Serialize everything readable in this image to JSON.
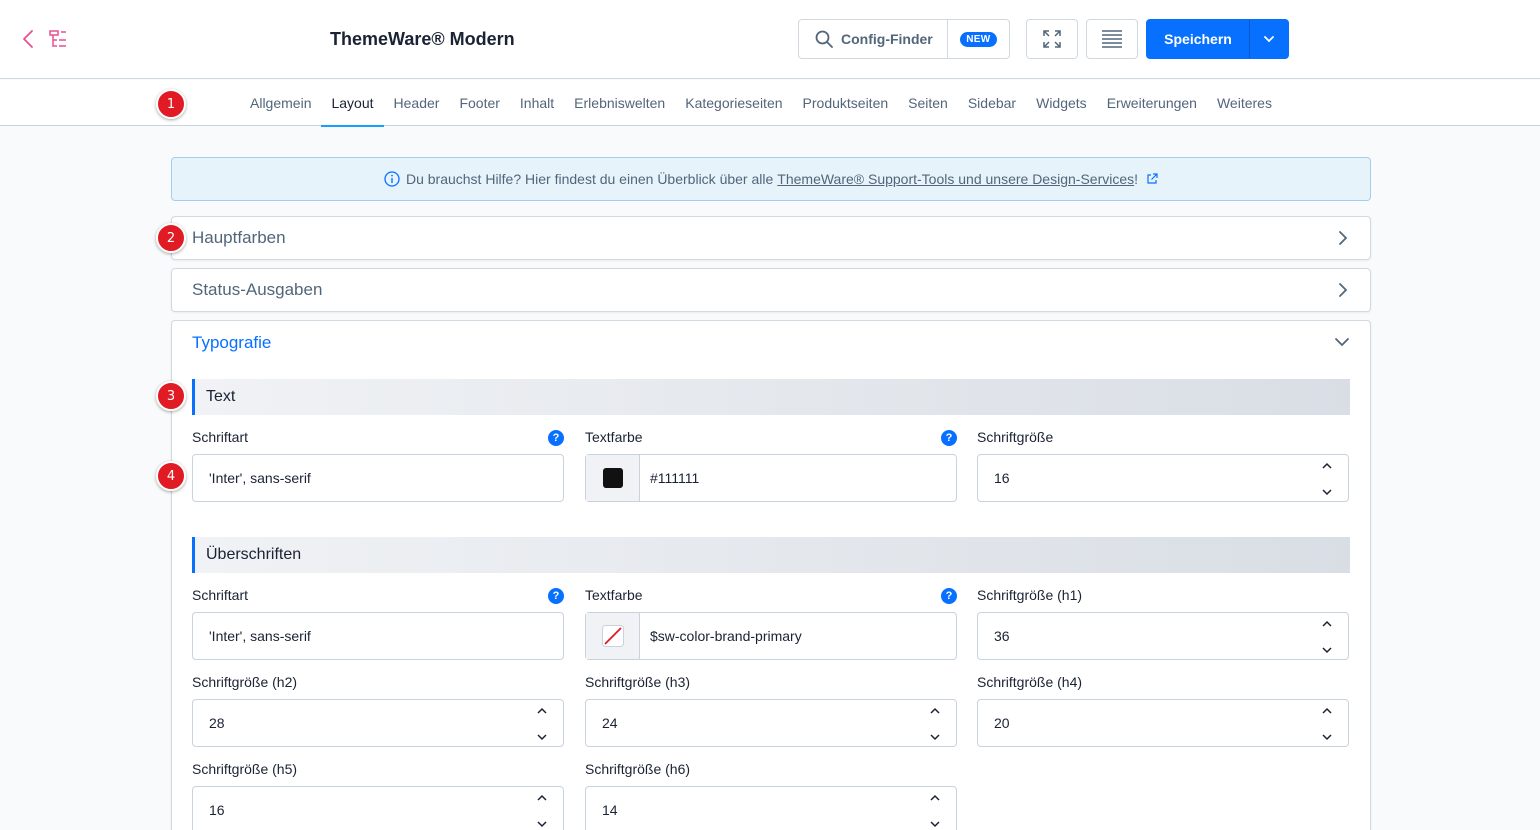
{
  "header": {
    "title": "ThemeWare® Modern",
    "config_finder_label": "Config-Finder",
    "new_badge": "NEW",
    "save_label": "Speichern",
    "accent_color": "#0870ff"
  },
  "tabs": [
    {
      "label": "Allgemein"
    },
    {
      "label": "Layout",
      "active": true
    },
    {
      "label": "Header"
    },
    {
      "label": "Footer"
    },
    {
      "label": "Inhalt"
    },
    {
      "label": "Erlebniswelten"
    },
    {
      "label": "Kategorieseiten"
    },
    {
      "label": "Produktseiten"
    },
    {
      "label": "Seiten"
    },
    {
      "label": "Sidebar"
    },
    {
      "label": "Widgets"
    },
    {
      "label": "Erweiterungen"
    },
    {
      "label": "Weiteres"
    }
  ],
  "markers": [
    "1",
    "2",
    "3",
    "4"
  ],
  "info": {
    "text": "Du brauchst Hilfe? Hier findest du einen Überblick über alle",
    "link": "ThemeWare® Support-Tools und unsere Design-Services",
    "suffix": "!"
  },
  "cards": {
    "hauptfarben": "Hauptfarben",
    "status": "Status-Ausgaben",
    "typografie": "Typografie"
  },
  "text_section": {
    "title": "Text",
    "font_label": "Schriftart",
    "font_value": "'Inter', sans-serif",
    "color_label": "Textfarbe",
    "color_value": "#111111",
    "size_label": "Schriftgröße",
    "size_value": "16"
  },
  "headings_section": {
    "title": "Überschriften",
    "font_label": "Schriftart",
    "font_value": "'Inter', sans-serif",
    "color_label": "Textfarbe",
    "color_value": "$sw-color-brand-primary",
    "h1_label": "Schriftgröße (h1)",
    "h1_value": "36",
    "h2_label": "Schriftgröße (h2)",
    "h2_value": "28",
    "h3_label": "Schriftgröße (h3)",
    "h3_value": "24",
    "h4_label": "Schriftgröße (h4)",
    "h4_value": "20",
    "h5_label": "Schriftgröße (h5)",
    "h5_value": "16",
    "h6_label": "Schriftgröße (h6)",
    "h6_value": "14"
  }
}
